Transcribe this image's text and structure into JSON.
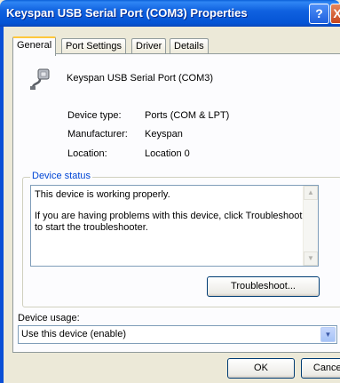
{
  "window": {
    "title": "Keyspan USB Serial Port (COM3) Properties",
    "help_glyph": "?",
    "close_glyph": "X"
  },
  "tabs": [
    {
      "label": "General"
    },
    {
      "label": "Port Settings"
    },
    {
      "label": "Driver"
    },
    {
      "label": "Details"
    }
  ],
  "device": {
    "name": "Keyspan USB Serial Port (COM3)",
    "icon": "serial-port-connector-icon",
    "properties": [
      {
        "label": "Device type:",
        "value": "Ports (COM & LPT)"
      },
      {
        "label": "Manufacturer:",
        "value": "Keyspan"
      },
      {
        "label": "Location:",
        "value": "Location 0"
      }
    ]
  },
  "status": {
    "legend": "Device status",
    "line1": "This device is working properly.",
    "line2": "If you are having problems with this device, click Troubleshoot to start the troubleshooter.",
    "troubleshoot_label": "Troubleshoot..."
  },
  "usage": {
    "label": "Device usage:",
    "selected": "Use this device (enable)"
  },
  "footer": {
    "ok_label": "OK",
    "cancel_label": "Cancel"
  }
}
